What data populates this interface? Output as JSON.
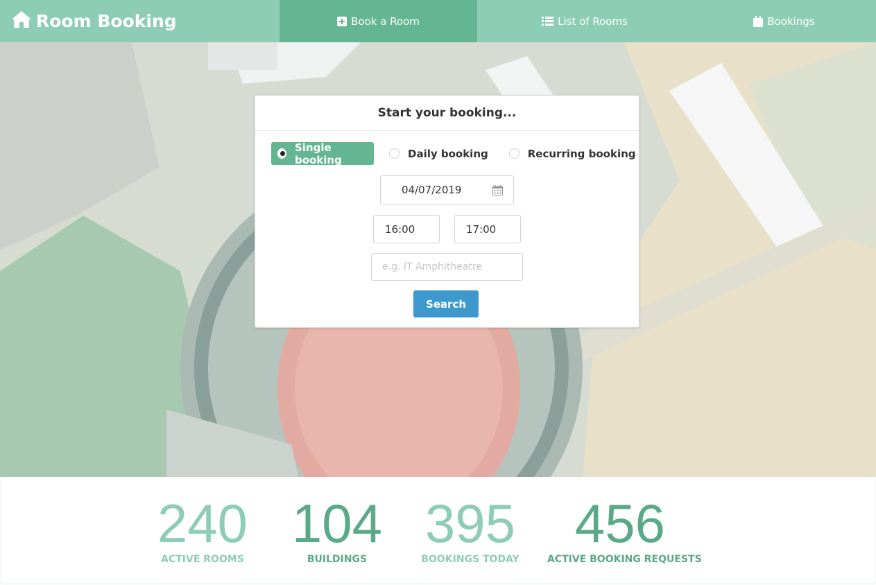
{
  "navbar": {
    "brand": "Room Booking",
    "tabs": [
      {
        "label": "Book a Room",
        "icon": "plus-square-icon"
      },
      {
        "label": "List of Rooms",
        "icon": "list-icon"
      },
      {
        "label": "Bookings",
        "icon": "calendar-icon"
      }
    ]
  },
  "booking": {
    "title": "Start your booking...",
    "options": [
      "Single booking",
      "Daily booking",
      "Recurring booking"
    ],
    "selected_option": "Single booking",
    "date": "04/07/2019",
    "start_time": "16:00",
    "end_time": "17:00",
    "room_placeholder": "e.g. IT Amphitheatre",
    "search_label": "Search"
  },
  "stats": [
    {
      "value": "240",
      "label": "ACTIVE ROOMS"
    },
    {
      "value": "104",
      "label": "BUILDINGS"
    },
    {
      "value": "395",
      "label": "BOOKINGS TODAY"
    },
    {
      "value": "456",
      "label": "ACTIVE BOOKING REQUESTS"
    }
  ],
  "colors": {
    "nav": "#8ecdb5",
    "nav_active": "#64b592",
    "button": "#3d98cd",
    "stat_light": "#8ecdb5",
    "stat_dark": "#5aa988"
  }
}
